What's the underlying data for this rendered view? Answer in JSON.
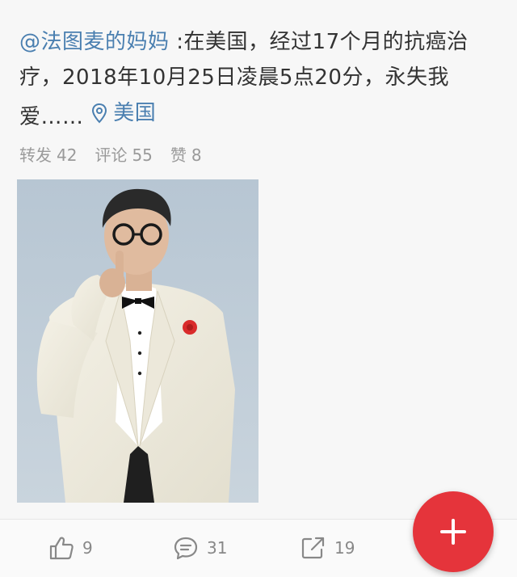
{
  "post": {
    "mention": "@法图麦的妈妈",
    "text": " :在美国，经过17个月的抗癌治疗，2018年10月25日凌晨5点20分，永失我爱……",
    "location": "美国"
  },
  "stats": {
    "reposts_label": "转发",
    "reposts_count": "42",
    "comments_label": "评论",
    "comments_count": "55",
    "likes_label": "赞",
    "likes_count": "8"
  },
  "bottom_bar": {
    "like_count": "9",
    "comment_count": "31",
    "share_count": "19"
  },
  "icons": {
    "location": "location-pin-icon",
    "like": "thumbs-up-icon",
    "comment": "comment-bubble-icon",
    "share": "share-arrow-icon",
    "fab": "plus-icon"
  },
  "colors": {
    "link": "#4a7fb0",
    "fab": "#e5343b"
  }
}
